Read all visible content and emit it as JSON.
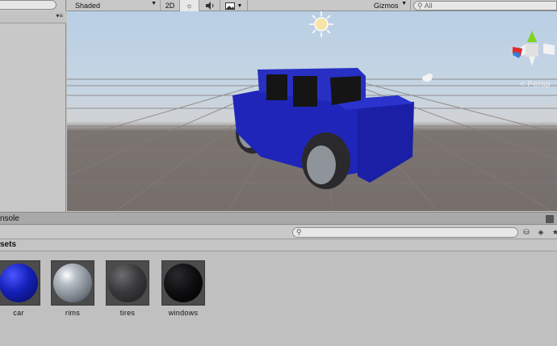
{
  "scene_toolbar": {
    "shading_mode": "Shaded",
    "mode_2d": "2D",
    "lighting_icon": "sun-icon",
    "audio_icon": "speaker-icon",
    "effects_icon": "image-icon",
    "gizmos_label": "Gizmos",
    "search_placeholder": "All"
  },
  "viewport": {
    "projection_label": "Persp",
    "car_color": "#1f25b8"
  },
  "console": {
    "tab_label": "nsole"
  },
  "project": {
    "folder_title": "sets",
    "assets": [
      {
        "name": "car",
        "material_color": "#1520b8"
      },
      {
        "name": "rims",
        "material_color": "#9aa3ad"
      },
      {
        "name": "tires",
        "material_color": "#3a3a3c"
      },
      {
        "name": "windows",
        "material_color": "#0d0d0f"
      }
    ]
  }
}
